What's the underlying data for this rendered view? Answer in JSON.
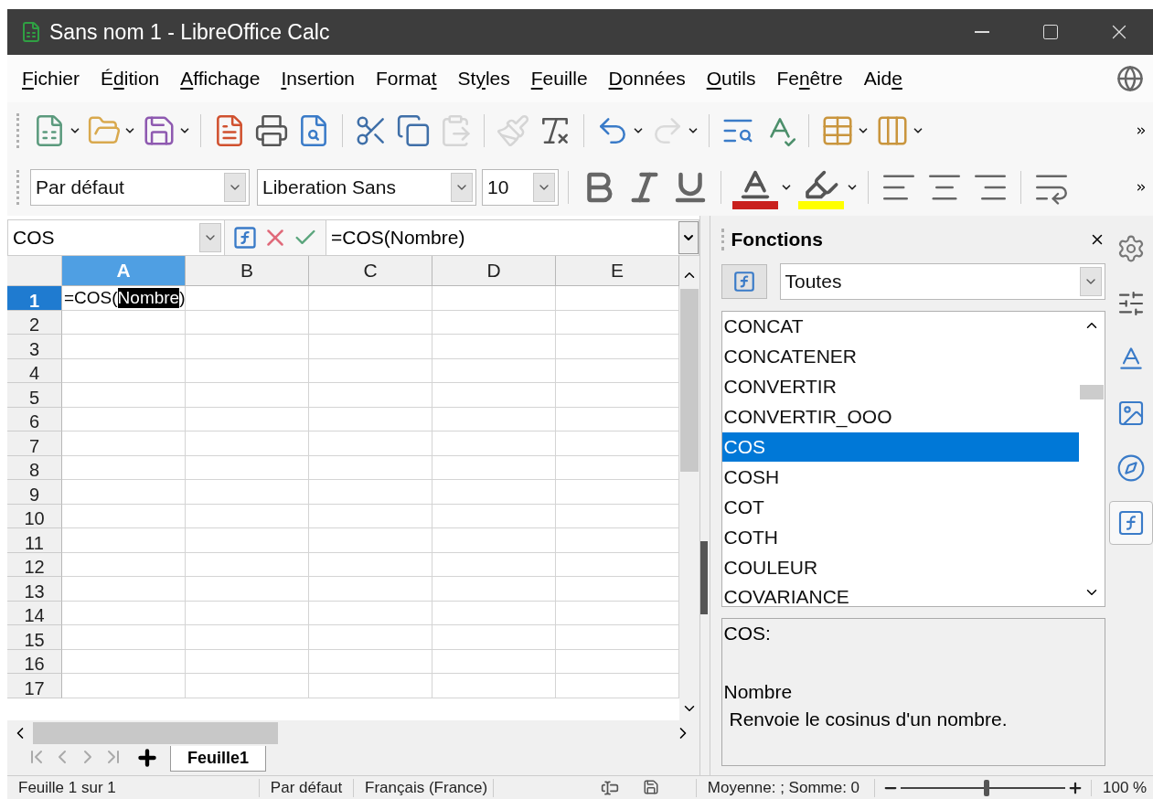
{
  "window": {
    "title": "Sans nom 1 - LibreOffice Calc"
  },
  "menu": [
    {
      "key": "F",
      "after": "ichier"
    },
    {
      "before": "É",
      "key": "d",
      "after": "ition"
    },
    {
      "key": "A",
      "after": "ffichage"
    },
    {
      "key": "I",
      "after": "nsertion"
    },
    {
      "before": "Forma",
      "key": "t"
    },
    {
      "before": "St",
      "key": "y",
      "after": "les"
    },
    {
      "key": "F",
      "after": "euille"
    },
    {
      "key": "D",
      "after": "onnées"
    },
    {
      "key": "O",
      "after": "utils"
    },
    {
      "before": "Fe",
      "key": "n",
      "after": "être"
    },
    {
      "before": "Aid",
      "key": "e"
    }
  ],
  "standard_toolbar": {
    "groups": [
      [
        {
          "dropdown": true,
          "disabled": false
        },
        {
          "dropdown": true,
          "disabled": false
        },
        {
          "dropdown": true,
          "disabled": false
        }
      ],
      [
        {
          "dropdown": false,
          "disabled": false
        },
        {
          "dropdown": false,
          "disabled": false
        },
        {
          "dropdown": false,
          "disabled": false
        }
      ],
      [
        {
          "dropdown": false,
          "disabled": false
        },
        {
          "dropdown": false,
          "disabled": false
        },
        {
          "dropdown": false,
          "disabled": true
        }
      ],
      [
        {
          "dropdown": false,
          "disabled": true
        },
        {
          "dropdown": false,
          "disabled": false
        }
      ],
      [
        {
          "dropdown": true,
          "disabled": false
        },
        {
          "dropdown": true,
          "disabled": true
        }
      ],
      [
        {
          "dropdown": false,
          "disabled": false
        },
        {
          "dropdown": false,
          "disabled": false
        }
      ],
      [
        {
          "dropdown": true,
          "disabled": false
        },
        {
          "dropdown": true,
          "disabled": false
        }
      ]
    ]
  },
  "formatting_toolbar": {
    "style": "Par défaut",
    "font": "Liberation Sans",
    "size": "10",
    "groups": [
      [
        {
          "dropdown": false
        },
        {
          "dropdown": false
        },
        {
          "dropdown": false
        }
      ],
      [
        {
          "dropdown": true,
          "color": "#c9211e"
        },
        {
          "dropdown": true,
          "color": "#ffff00"
        }
      ],
      [
        {
          "dropdown": false
        },
        {
          "dropdown": false
        },
        {
          "dropdown": false
        }
      ],
      [
        {
          "dropdown": false
        }
      ]
    ]
  },
  "formula_bar": {
    "name_box": "COS",
    "content": "=COS(Nombre)"
  },
  "grid": {
    "columns": [
      {
        "label": "A",
        "selected": true
      },
      {
        "label": "B",
        "selected": false
      },
      {
        "label": "C",
        "selected": false
      },
      {
        "label": "D",
        "selected": false
      },
      {
        "label": "E",
        "selected": false
      }
    ],
    "rows": [
      {
        "label": "1",
        "selected": true
      },
      {
        "label": "2",
        "selected": false
      },
      {
        "label": "3",
        "selected": false
      },
      {
        "label": "4",
        "selected": false
      },
      {
        "label": "5",
        "selected": false
      },
      {
        "label": "6",
        "selected": false
      },
      {
        "label": "7",
        "selected": false
      },
      {
        "label": "8",
        "selected": false
      },
      {
        "label": "9",
        "selected": false
      },
      {
        "label": "10",
        "selected": false
      },
      {
        "label": "11",
        "selected": false
      },
      {
        "label": "12",
        "selected": false
      },
      {
        "label": "13",
        "selected": false
      },
      {
        "label": "14",
        "selected": false
      },
      {
        "label": "15",
        "selected": false
      },
      {
        "label": "16",
        "selected": false
      },
      {
        "label": "17",
        "selected": false
      }
    ],
    "active_cell": {
      "before": "=COS(",
      "selected_text": "Nombre",
      "after": ")"
    }
  },
  "sheet_tabs": [
    {
      "label": "Feuille1",
      "selected": true
    }
  ],
  "functions_panel": {
    "title": "Fonctions",
    "category": "Toutes",
    "functions": [
      {
        "name": "CONCAT",
        "selected": false
      },
      {
        "name": "CONCATENER",
        "selected": false
      },
      {
        "name": "CONVERTIR",
        "selected": false
      },
      {
        "name": "CONVERTIR_OOO",
        "selected": false
      },
      {
        "name": "COS",
        "selected": true
      },
      {
        "name": "COSH",
        "selected": false
      },
      {
        "name": "COT",
        "selected": false
      },
      {
        "name": "COTH",
        "selected": false
      },
      {
        "name": "COULEUR",
        "selected": false
      },
      {
        "name": "COVARIANCE",
        "selected": false
      }
    ],
    "description": {
      "signature": "COS:",
      "argument": "Nombre",
      "text": "Renvoie le cosinus d'un nombre."
    }
  },
  "sidebar_tabs": [
    {
      "selected": false
    },
    {
      "selected": false
    },
    {
      "selected": false
    },
    {
      "selected": false
    },
    {
      "selected": false
    },
    {
      "selected": true
    }
  ],
  "status_bar": {
    "sheet": "Feuille 1 sur 1",
    "page_style": "Par défaut",
    "language": "Français (France)",
    "summary": "Moyenne: ; Somme: 0",
    "zoom": {
      "level": 0.52
    },
    "zoom_reading": "100 %"
  }
}
